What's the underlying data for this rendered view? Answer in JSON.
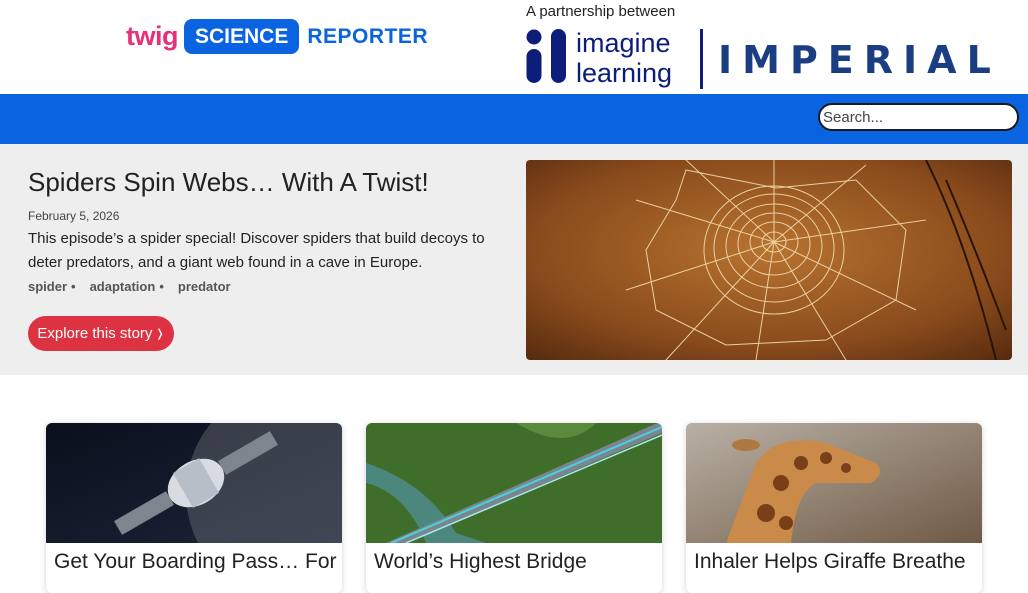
{
  "header": {
    "brand_twig": "twig",
    "brand_science": "SCIENCE",
    "brand_reporter": "REPORTER",
    "partnership_text": "A partnership between",
    "partner1_line1": "imagine",
    "partner1_line2": "learning",
    "partner2": "IMPERIAL"
  },
  "search": {
    "placeholder": "Search..."
  },
  "featured": {
    "title": "Spiders Spin Webs… With A Twist!",
    "date": "February 5, 2026",
    "description": "This episode’s a spider special! Discover spiders that build decoys to deter predators, and a giant web found in a cave in Europe.",
    "tags": [
      "spider",
      "adaptation",
      "predator"
    ],
    "button_label": "Explore this story",
    "button_arrow": "❭"
  },
  "cards": [
    {
      "title": "Get Your Boarding Pass… For"
    },
    {
      "title": "World’s Highest Bridge"
    },
    {
      "title": "Inhaler Helps Giraffe Breathe"
    }
  ],
  "colors": {
    "brand_blue": "#0a63e0",
    "twig_pink": "#e4317a",
    "button_red": "#dd3241",
    "imagine_navy": "#0c1e7a"
  }
}
